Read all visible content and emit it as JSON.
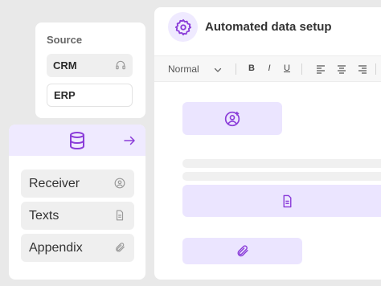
{
  "source": {
    "title": "Source",
    "options": [
      {
        "label": "CRM",
        "icon": "headset-icon",
        "selected": true
      },
      {
        "label": "ERP",
        "selected": false
      }
    ]
  },
  "left_panel": {
    "header_icon": "database-icon",
    "header_action_icon": "arrow-right-icon",
    "items": [
      {
        "label": "Receiver",
        "icon": "user-at-icon"
      },
      {
        "label": "Texts",
        "icon": "document-icon"
      },
      {
        "label": "Appendix",
        "icon": "paperclip-icon"
      }
    ]
  },
  "editor": {
    "title": "Automated data setup",
    "title_icon": "gear-icon",
    "toolbar": {
      "style_value": "Normal",
      "bold": "B",
      "italic": "I",
      "underline": "U",
      "align_icons": [
        "align-left-icon",
        "align-center-icon",
        "align-right-icon"
      ]
    },
    "blocks": [
      {
        "type": "receiver",
        "icon": "user-plus-icon"
      },
      {
        "type": "texts",
        "icon": "document-icon"
      },
      {
        "type": "appendix",
        "icon": "paperclip-icon"
      }
    ]
  },
  "colors": {
    "accent": "#8b3dd9",
    "accent_light": "#efeaff",
    "block": "#ebe5ff",
    "background": "#e9e9e9"
  }
}
